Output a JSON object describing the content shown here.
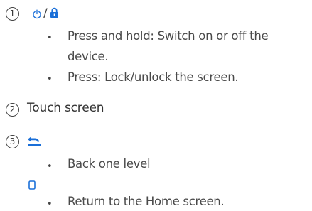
{
  "items": [
    {
      "number": "1",
      "icons": [
        "power-icon",
        "lock-icon"
      ],
      "separator": "/",
      "color": "#1a6fd8",
      "bullets": [
        {
          "line1": "Press and hold: Switch on or off the",
          "line2": "device."
        },
        {
          "line1": "Press: Lock/unlock the screen."
        }
      ]
    },
    {
      "number": "2",
      "title": "Touch screen"
    },
    {
      "number": "3",
      "icons": [
        "back-icon",
        "home-icon"
      ],
      "bullets": [
        {
          "line1": "Back one level"
        },
        {
          "line1": "Return to the Home screen."
        }
      ]
    }
  ]
}
